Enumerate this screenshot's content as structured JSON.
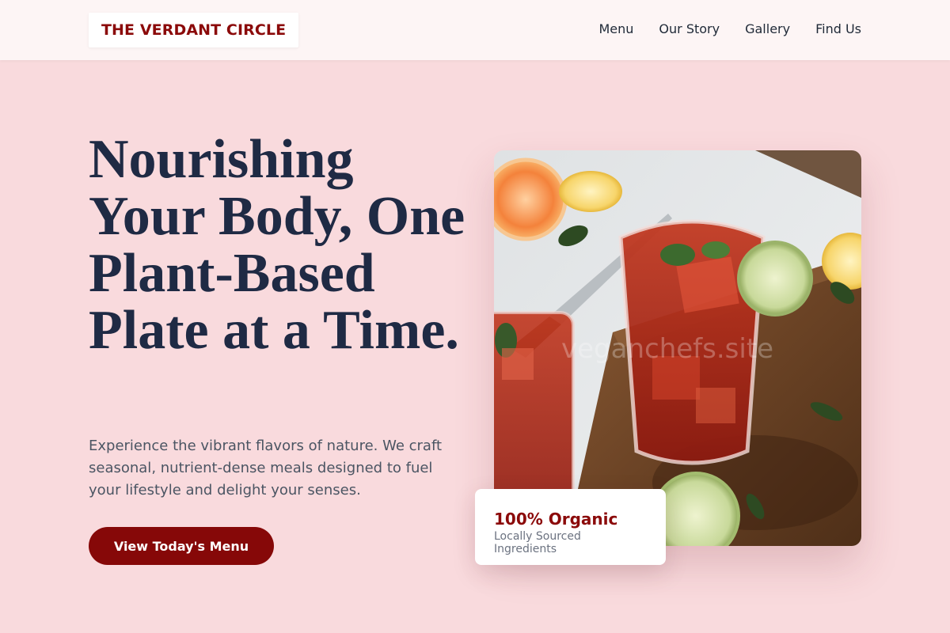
{
  "brand": {
    "name": "THE VERDANT CIRCLE"
  },
  "nav": {
    "items": [
      {
        "label": "Menu"
      },
      {
        "label": "Our Story"
      },
      {
        "label": "Gallery"
      },
      {
        "label": "Find Us"
      }
    ]
  },
  "hero": {
    "title": "Nourishing Your Body, One Plant-Based Plate at a Time.",
    "description": "Experience the vibrant flavors of nature. We craft seasonal, nutrient-dense meals designed to fuel your lifestyle and delight your senses.",
    "cta_label": "View Today's Menu",
    "image_watermark": "veganchefs.site"
  },
  "badge": {
    "title": "100% Organic",
    "subtitle": "Locally Sourced Ingredients"
  },
  "colors": {
    "page_background": "#f9dadd",
    "nav_background": "#fdf5f5",
    "brand_red": "#8b0a0a",
    "heading_navy": "#1f2a44",
    "body_gray": "#4b5563"
  }
}
